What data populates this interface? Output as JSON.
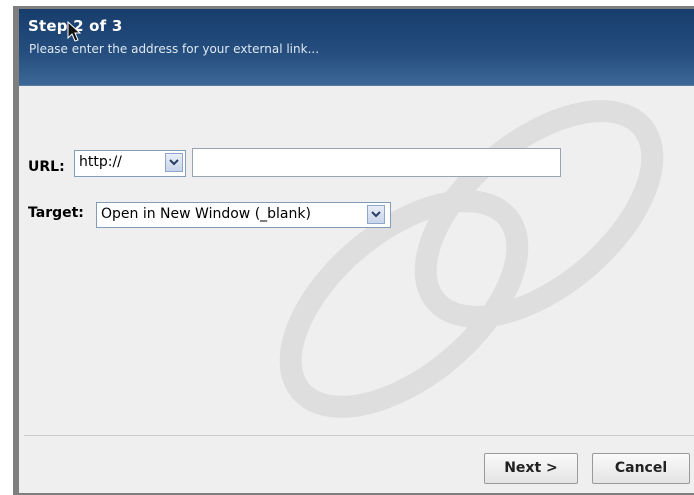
{
  "header": {
    "title": "Step 2 of 3",
    "subtitle": "Please enter the address for your external link..."
  },
  "form": {
    "url_label": "URL:",
    "protocol_selected": "http://",
    "url_value": "",
    "target_label": "Target:",
    "target_selected": "Open in New Window (_blank)"
  },
  "buttons": {
    "next": "Next >",
    "cancel": "Cancel"
  },
  "icons": {
    "watermark": "chain-link-icon",
    "dropdown": "chevron-down-icon",
    "cursor": "mouse-pointer-icon"
  },
  "colors": {
    "header_top": "#173d6c",
    "header_bottom": "#3c6797",
    "dialog_bg": "#efefef"
  }
}
